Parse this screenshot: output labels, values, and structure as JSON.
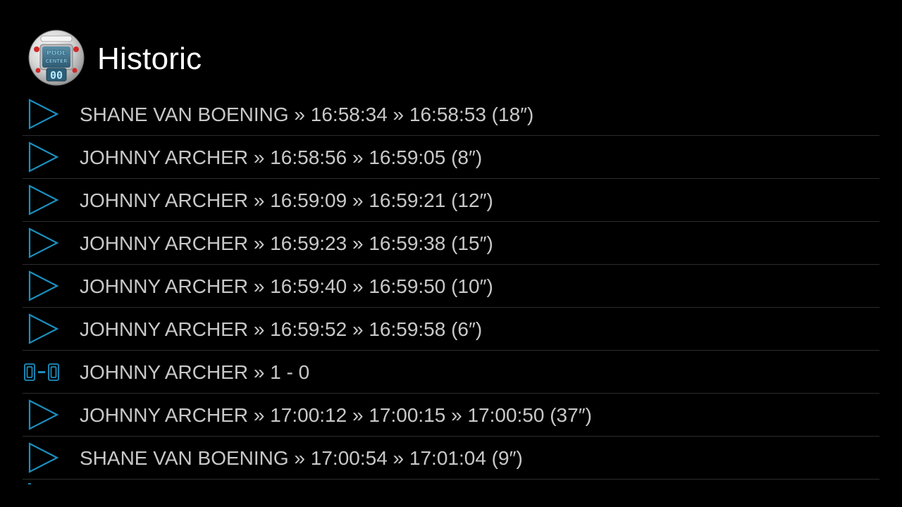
{
  "header": {
    "title": "Historic",
    "app_icon": "pool-center-logo",
    "logo_text": [
      "POOL",
      "CENTER",
      "00"
    ]
  },
  "colors": {
    "background": "#000000",
    "accent": "#1b8fbf",
    "text": "#c8c8c8",
    "title": "#ffffff",
    "divider": "#2c2c2c"
  },
  "history": {
    "items": [
      {
        "icon": "play-icon",
        "text": "SHANE VAN BOENING » 16:58:34 » 16:58:53 (18″)"
      },
      {
        "icon": "play-icon",
        "text": "JOHNNY ARCHER » 16:58:56 » 16:59:05 (8″)"
      },
      {
        "icon": "play-icon",
        "text": "JOHNNY ARCHER » 16:59:09 » 16:59:21 (12″)"
      },
      {
        "icon": "play-icon",
        "text": "JOHNNY ARCHER » 16:59:23 » 16:59:38 (15″)"
      },
      {
        "icon": "play-icon",
        "text": "JOHNNY ARCHER » 16:59:40 » 16:59:50 (10″)"
      },
      {
        "icon": "play-icon",
        "text": "JOHNNY ARCHER » 16:59:52 » 16:59:58 (6″)"
      },
      {
        "icon": "score-icon",
        "text": "JOHNNY ARCHER » 1 - 0"
      },
      {
        "icon": "play-icon",
        "text": "JOHNNY ARCHER » 17:00:12 » 17:00:15 » 17:00:50 (37″)"
      },
      {
        "icon": "play-icon",
        "text": "SHANE VAN BOENING » 17:00:54 » 17:01:04 (9″)"
      }
    ]
  }
}
